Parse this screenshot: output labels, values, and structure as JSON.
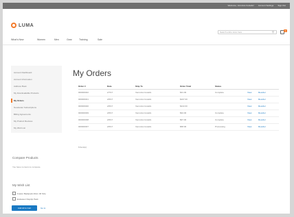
{
  "topbar": {
    "links": [
      "Welcome, Veronica Costello!",
      "Account Settings",
      "Sign Out"
    ]
  },
  "logo": {
    "text": "LUMA"
  },
  "search": {
    "placeholder": "Search entire store here..."
  },
  "cart": {
    "count": "2"
  },
  "nav": {
    "items": [
      "What's New",
      "Women",
      "Men",
      "Gear",
      "Training",
      "Sale"
    ]
  },
  "sidebar": {
    "items": [
      "Account Dashboard",
      "Account Information",
      "Address Book",
      "My Downloadable Products",
      "My Orders",
      "Newsletter Subscriptions",
      "Billing Agreements",
      "My Product Reviews",
      "My Wish List"
    ]
  },
  "compare": {
    "title": "Compare Products",
    "text": "You have no items to compare."
  },
  "wishlist": {
    "title": "My Wish List",
    "items": [
      "Fusion Backpack 40cm 30 Size",
      "Endeavor Daytrip Pack"
    ],
    "add_all": "Add All to Cart",
    "go_link": "Go to"
  },
  "main": {
    "title": "My Orders",
    "columns": [
      "Order #",
      "Date",
      "Ship To",
      "Order Total",
      "Status",
      "",
      ""
    ],
    "rows": [
      [
        "000000042",
        "2/7/17",
        "Veronica Costello",
        "$31.00",
        "Complete",
        "View",
        "Reorder"
      ],
      [
        "000000041",
        "2/6/17",
        "Veronica Costello",
        "$107.00",
        "",
        "View",
        "Reorder"
      ],
      [
        "000000040",
        "2/6/17",
        "Veronica Costello",
        "$113.00",
        "",
        "View",
        "Reorder"
      ],
      [
        "000000039",
        "2/6/17",
        "Veronica Costello",
        "$94.00",
        "Complete",
        "View",
        "Reorder"
      ],
      [
        "000000038",
        "2/6/17",
        "Veronica Costello",
        "$97.00",
        "Complete",
        "View",
        "Reorder"
      ],
      [
        "000000037",
        "2/6/17",
        "Veronica Costello",
        "$58.00",
        "Processing",
        "View",
        "Reorder"
      ]
    ],
    "items_count": "6 Item(s)"
  }
}
